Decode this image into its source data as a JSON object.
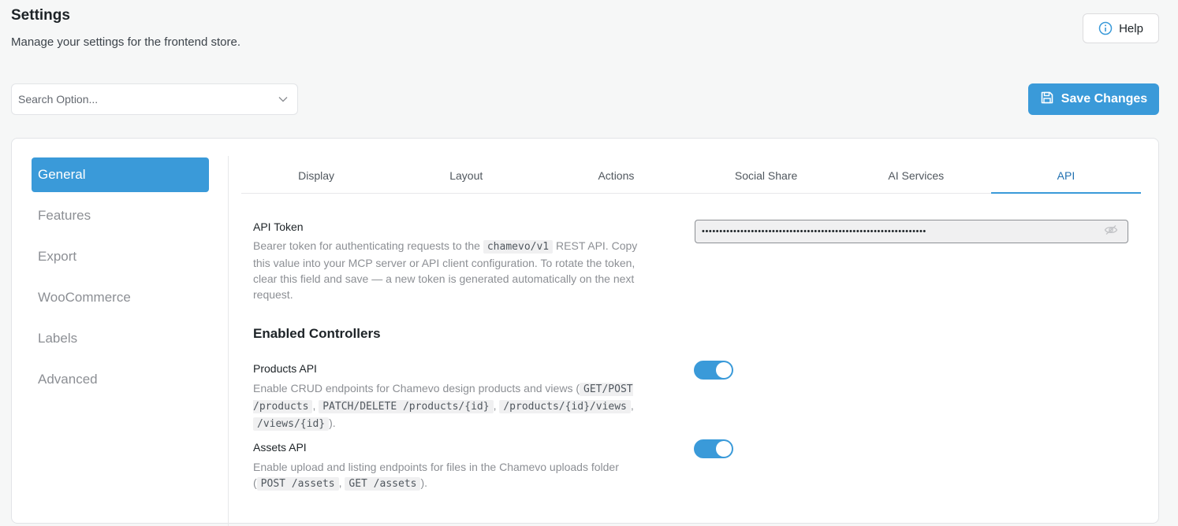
{
  "header": {
    "title": "Settings",
    "subtitle": "Manage your settings for the frontend store.",
    "help_label": "Help"
  },
  "search": {
    "placeholder": "Search Option..."
  },
  "toolbar": {
    "save_label": "Save Changes"
  },
  "sidebar": {
    "items": [
      {
        "label": "General",
        "active": true
      },
      {
        "label": "Features"
      },
      {
        "label": "Export"
      },
      {
        "label": "WooCommerce"
      },
      {
        "label": "Labels"
      },
      {
        "label": "Advanced"
      }
    ]
  },
  "tabs": [
    {
      "label": "Display"
    },
    {
      "label": "Layout"
    },
    {
      "label": "Actions"
    },
    {
      "label": "Social Share"
    },
    {
      "label": "AI Services"
    },
    {
      "label": "API",
      "active": true
    }
  ],
  "api_token": {
    "label": "API Token",
    "desc_1": "Bearer token for authenticating requests to the ",
    "desc_code": "chamevo/v1",
    "desc_2": " REST API. Copy this value into your MCP server or API client configuration. To rotate the token, clear this field and save — a new token is generated automatically on the next request.",
    "masked_value": "••••••••••••••••••••••••••••••••••••••••••••••••••••••••••••••••"
  },
  "enabled_controllers": {
    "title": "Enabled Controllers",
    "products": {
      "label": "Products API",
      "desc_1": "Enable CRUD endpoints for Chamevo design products and views (",
      "code_1": "GET/POST /products",
      "sep_1": ", ",
      "code_2": "PATCH/DELETE /products/{id}",
      "sep_2": ", ",
      "code_3": "/products/{id}/views",
      "sep_3": ", ",
      "code_4": "/views/{id}",
      "desc_end": ").",
      "enabled": true
    },
    "assets": {
      "label": "Assets API",
      "desc_1": "Enable upload and listing endpoints for files in the Chamevo uploads folder (",
      "code_1": "POST /assets",
      "sep_1": ", ",
      "code_2": "GET /assets",
      "desc_end": ").",
      "enabled": true
    }
  },
  "colors": {
    "accent": "#3a9ad9",
    "muted_text": "#8c8f94"
  }
}
